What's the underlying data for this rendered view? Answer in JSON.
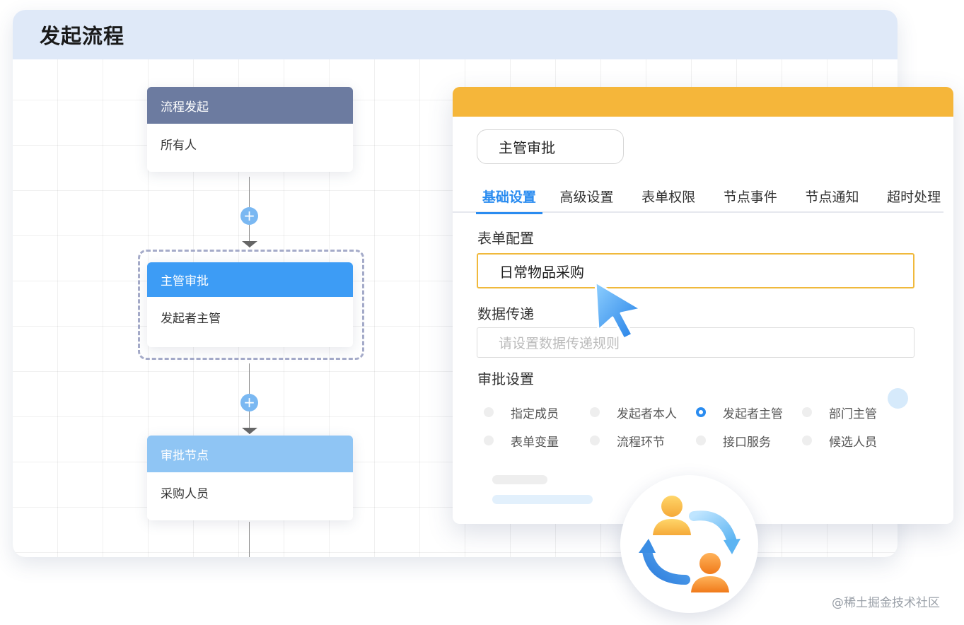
{
  "canvas": {
    "title": "发起流程"
  },
  "flow": {
    "nodes": [
      {
        "title": "流程发起",
        "content": "所有人"
      },
      {
        "title": "主管审批",
        "content": "发起者主管"
      },
      {
        "title": "审批节点",
        "content": "采购人员"
      }
    ],
    "add_symbol": "+"
  },
  "panel": {
    "node_name": "主管审批",
    "tabs": [
      "基础设置",
      "高级设置",
      "表单权限",
      "节点事件",
      "节点通知",
      "超时处理"
    ],
    "active_tab": "基础设置",
    "form_config": {
      "label": "表单配置",
      "value": "日常物品采购"
    },
    "data_transfer": {
      "label": "数据传递",
      "placeholder": "请设置数据传递规则"
    },
    "approval_settings": {
      "label": "审批设置",
      "options": [
        [
          "指定成员",
          "发起者本人",
          "发起者主管",
          "部门主管"
        ],
        [
          "表单变量",
          "流程环节",
          "接口服务",
          "候选人员"
        ]
      ],
      "selected": "发起者主管"
    }
  },
  "colors": {
    "header_bg": "#dfe9f8",
    "panel_topbar": "#f5b63a",
    "accent": "#2a8cf0",
    "node_start": "#6c7ba0",
    "node_manager": "#3d9cf5",
    "node_approve": "#8fc5f4"
  },
  "icons": {
    "cursor": "mouse-pointer-icon",
    "badge": "user-cycle-icon"
  },
  "watermark": "@稀土掘金技术社区"
}
